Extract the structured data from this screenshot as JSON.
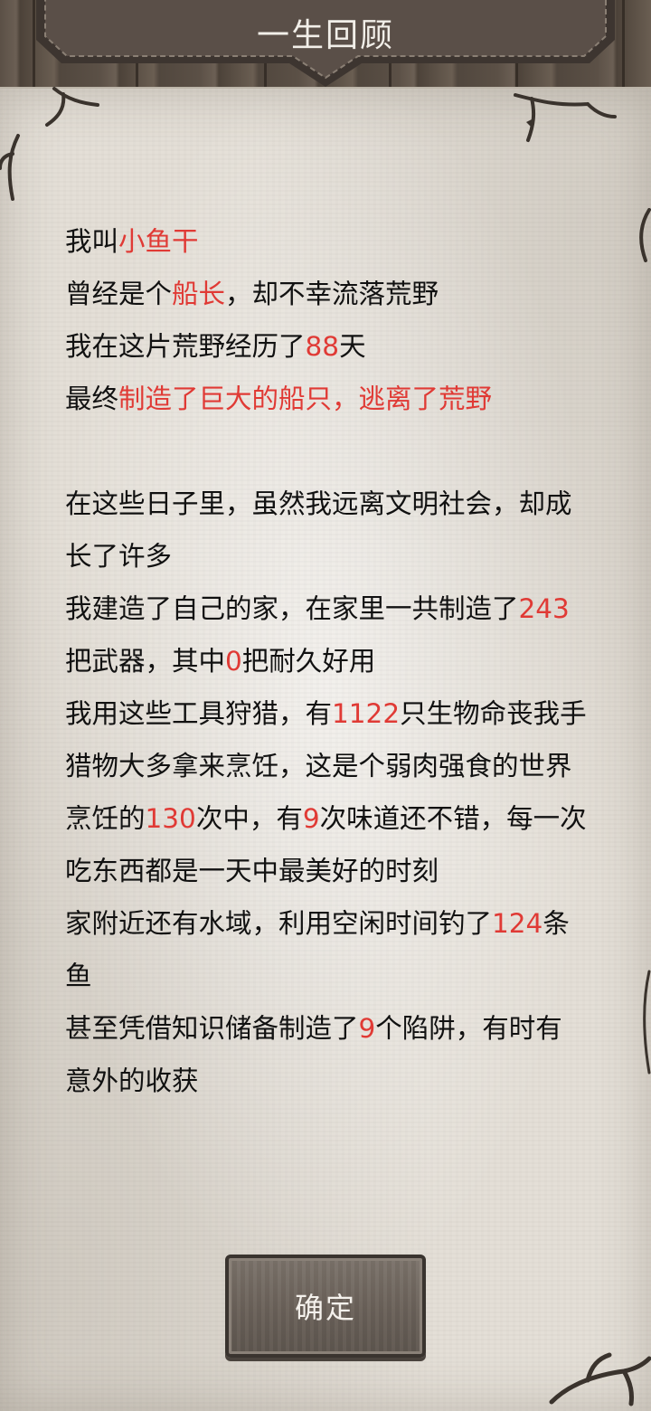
{
  "header": {
    "title": "一生回顾"
  },
  "story": {
    "paragraph1": [
      {
        "text": "我叫",
        "highlight": "小鱼干",
        "after": ""
      },
      {
        "text": "曾经是个",
        "highlight": "船长",
        "after": "，却不幸流落荒野"
      },
      {
        "text": "我在这片荒野经历了",
        "highlight": "88",
        "after": "天"
      },
      {
        "text": "最终",
        "highlight": "制造了巨大的船只，逃离了荒野",
        "after": ""
      }
    ],
    "line_civilization_1": "在这些日子里，虽然我远离文明社会，却成",
    "line_civilization_2": "长了许多",
    "line_home_1_before": "我建造了自己的家，在家里一共制造了",
    "weapons_made": "243",
    "line_home_2_before": "把武器，其中",
    "weapons_durable": "0",
    "line_home_2_after": "把耐久好用",
    "line_hunt_before": "我用这些工具狩猎，有",
    "creatures_killed": "1122",
    "line_hunt_after": "只生物命丧我手",
    "line_prey": "猎物大多拿来烹饪，这是个弱肉强食的世界",
    "line_cook_before": "烹饪的",
    "cook_count": "130",
    "line_cook_mid": "次中，有",
    "tasty_count": "9",
    "line_cook_after": "次味道还不错，每一次",
    "line_eat": "吃东西都是一天中最美好的时刻",
    "line_fish_before": "家附近还有水域，利用空闲时间钓了",
    "fish_count": "124",
    "line_fish_after": "条",
    "line_fish_end": "鱼",
    "line_trap_before": "甚至凭借知识储备制造了",
    "trap_count": "9",
    "line_trap_after": "个陷阱，有时有",
    "line_trap_end": "意外的收获"
  },
  "buttons": {
    "confirm_label": "确定"
  },
  "colors": {
    "highlight": "#e03a35",
    "text": "#111111",
    "paper": "#e4dfd7",
    "banner": "#5a4f48"
  }
}
